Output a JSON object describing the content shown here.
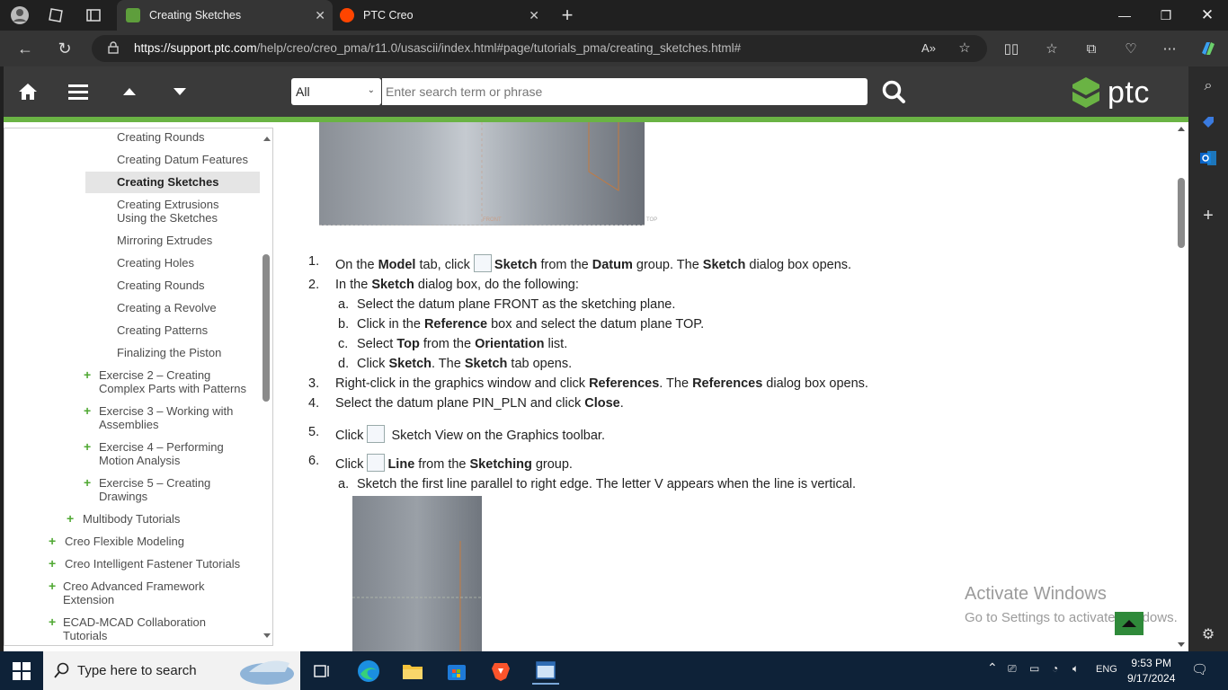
{
  "browser": {
    "tabs": [
      {
        "title": "Creating Sketches",
        "active": true
      },
      {
        "title": "PTC Creo",
        "active": false
      }
    ],
    "url_host": "https://support.ptc.com",
    "url_path": "/help/creo/creo_pma/r11.0/usascii/index.html#page/tutorials_pma/creating_sketches.html#"
  },
  "header": {
    "search_scope": "All",
    "search_placeholder": "Enter search term or phrase",
    "logo_text": "ptc"
  },
  "toc": {
    "items": [
      {
        "label": "Creating Rounds"
      },
      {
        "label": "Creating Datum Features"
      },
      {
        "label": "Creating Sketches",
        "selected": true
      },
      {
        "label_line1": "Creating Extrusions",
        "label_line2": "Using the Sketches"
      },
      {
        "label": "Mirroring Extrudes"
      },
      {
        "label": "Creating Holes"
      },
      {
        "label": "Creating Rounds"
      },
      {
        "label": "Creating a Revolve"
      },
      {
        "label": "Creating Patterns"
      },
      {
        "label": "Finalizing the Piston"
      },
      {
        "label_line1": "Exercise 2 – Creating",
        "label_line2": "Complex Parts with Patterns"
      },
      {
        "label_line1": "Exercise 3 – Working with",
        "label_line2": "Assemblies"
      },
      {
        "label_line1": "Exercise 4 – Performing",
        "label_line2": "Motion Analysis"
      },
      {
        "label_line1": "Exercise 5 – Creating",
        "label_line2": "Drawings"
      },
      {
        "label": "Multibody Tutorials"
      },
      {
        "label": "Creo Flexible Modeling"
      },
      {
        "label": "Creo Intelligent Fastener Tutorials"
      },
      {
        "label_line1": "Creo Advanced Framework",
        "label_line2": "Extension"
      },
      {
        "label_line1": "ECAD-MCAD Collaboration",
        "label_line2": "Tutorials"
      }
    ]
  },
  "content": {
    "img_labels": {
      "front": "FRONT",
      "top": "TOP"
    },
    "steps": [
      {
        "num": "1.",
        "parts": [
          "On the ",
          "Model",
          " tab, click ",
          "Sketch",
          " from the ",
          "Datum",
          " group. The ",
          "Sketch",
          " dialog box opens."
        ]
      },
      {
        "num": "2.",
        "parts": [
          "In the ",
          "Sketch",
          " dialog box, do the following:"
        ]
      },
      {
        "num": "3.",
        "parts": [
          "Right-click in the graphics window and click ",
          "References",
          ". The ",
          "References",
          " dialog box opens."
        ]
      },
      {
        "num": "4.",
        "parts": [
          "Select the datum plane PIN_PLN and click ",
          "Close",
          "."
        ]
      },
      {
        "num": "5.",
        "parts": [
          "Click ",
          " Sketch View on the Graphics toolbar."
        ]
      },
      {
        "num": "6.",
        "parts": [
          "Click ",
          "Line",
          " from the ",
          "Sketching",
          " group."
        ]
      }
    ],
    "substeps2": [
      {
        "letter": "a.",
        "parts": [
          "Select the datum plane FRONT as the sketching plane."
        ]
      },
      {
        "letter": "b.",
        "parts": [
          "Click in the ",
          "Reference",
          " box and select the datum plane TOP."
        ]
      },
      {
        "letter": "c.",
        "parts": [
          "Select ",
          "Top",
          " from the ",
          "Orientation",
          " list."
        ]
      },
      {
        "letter": "d.",
        "parts": [
          "Click ",
          "Sketch",
          ". The ",
          "Sketch",
          " tab opens."
        ]
      }
    ],
    "substeps6": [
      {
        "letter": "a.",
        "parts": [
          "Sketch the first line parallel to right edge. The letter V appears when the line is vertical."
        ]
      }
    ]
  },
  "watermark": {
    "line1": "Activate Windows",
    "line2": "Go to Settings to activate Windows."
  },
  "taskbar": {
    "search_placeholder": "Type here to search",
    "lang": "ENG",
    "time": "9:53 PM",
    "date": "9/17/2024"
  }
}
